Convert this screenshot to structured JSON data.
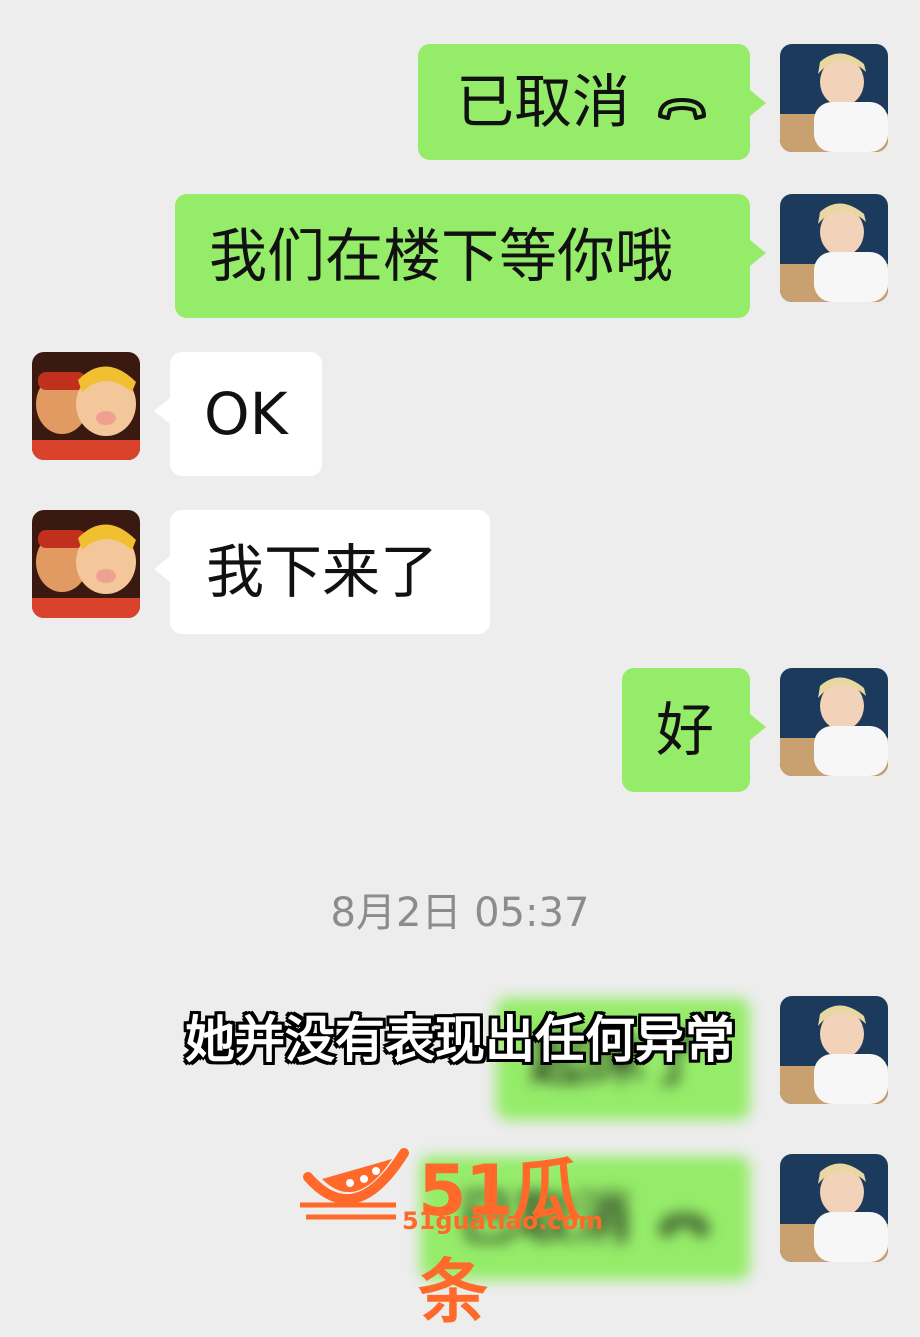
{
  "messages": [
    {
      "side": "me",
      "text": "已取消",
      "icon": "phone-hangup-icon"
    },
    {
      "side": "me",
      "text": "我们在楼下等你哦"
    },
    {
      "side": "them",
      "text": "OK"
    },
    {
      "side": "them",
      "text": "我下来了"
    },
    {
      "side": "me",
      "text": "好"
    }
  ],
  "timestamp": "8月2日 05:37",
  "caption": "她并没有表现出任何异常",
  "blurred_messages": [
    {
      "side": "me",
      "text": "起床了"
    },
    {
      "side": "me",
      "text": "已取消",
      "icon": "phone-hangup-icon"
    }
  ],
  "watermark": {
    "brand": "51瓜条",
    "url": "51guatiao.com"
  },
  "colors": {
    "my_bubble": "#95ec69",
    "their_bubble": "#ffffff",
    "background": "#ededed",
    "watermark": "#ff6a2b"
  }
}
